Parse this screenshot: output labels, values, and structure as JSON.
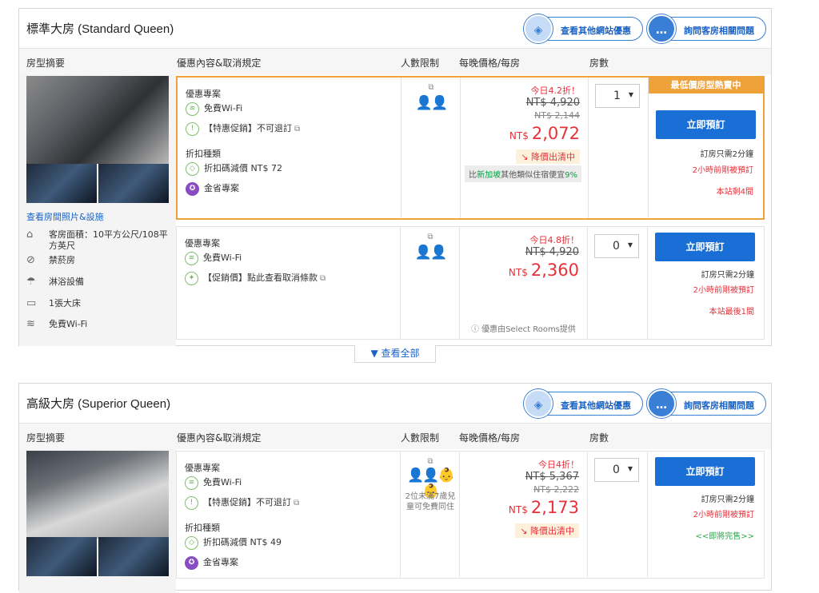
{
  "cards": [
    {
      "title": "標準大房 (Standard Queen)",
      "pill_other": "查看其他網站優惠",
      "pill_ask": "詢問客房相關問題",
      "columns": {
        "summary": "房型摘要",
        "offer": "優惠內容&取消規定",
        "occupancy": "人數限制",
        "price": "每晚價格/每房",
        "rooms": "房數"
      },
      "photo_link": "查看房間照片&設施",
      "features": [
        {
          "icon": "house-icon",
          "glyph": "⌂",
          "text": "客房面積：10平方公尺/108平方英尺"
        },
        {
          "icon": "no-smoking-icon",
          "glyph": "⊘",
          "text": "禁菸房"
        },
        {
          "icon": "shower-icon",
          "glyph": "☂",
          "text": "淋浴設備"
        },
        {
          "icon": "bed-icon",
          "glyph": "▭",
          "text": "1張大床"
        },
        {
          "icon": "wifi-icon",
          "glyph": "≋",
          "text": "免費Wi-Fi"
        }
      ],
      "offers": [
        {
          "section1": "優惠專案",
          "wifi": "免費Wi-Fi",
          "policy": "【特惠促銷】不可退訂",
          "section2": "折扣種類",
          "coupon": "折扣碼減價 NT$ 72",
          "gold": "金省專案",
          "discount": "今日4.2折！",
          "strike1": "NT$ 4,920",
          "strike2": "NT$ 2,144",
          "currency": "NT$",
          "price": "2,072",
          "drop": "↘ 降價出清中",
          "compare_pre": "比",
          "compare_hl": "新加坡",
          "compare_post": "其他類似住宿便宜",
          "compare_pct": "9%",
          "rooms": "1",
          "banner": "最低價房型熱賣中",
          "book": "立即預訂",
          "note1": "訂房只需2分鐘",
          "note2": "2小時前剛被預訂",
          "note3": "本站剩4間"
        },
        {
          "section1": "優惠專案",
          "wifi": "免費Wi-Fi",
          "policy": "【促銷價】點此查看取消條款",
          "discount": "今日4.8折！",
          "strike1": "NT$ 4,920",
          "currency": "NT$",
          "price": "2,360",
          "provider": "ⓘ 優惠由Select Rooms提供",
          "rooms": "0",
          "book": "立即預訂",
          "note1": "訂房只需2分鐘",
          "note2": "2小時前剛被預訂",
          "note3": "本站最後1間"
        }
      ],
      "expand": "▼ 查看全部"
    },
    {
      "title": "高級大房 (Superior Queen)",
      "pill_other": "查看其他網站優惠",
      "pill_ask": "詢問客房相關問題",
      "columns": {
        "summary": "房型摘要",
        "offer": "優惠內容&取消規定",
        "occupancy": "人數限制",
        "price": "每晚價格/每房",
        "rooms": "房數"
      },
      "offers": [
        {
          "section1": "優惠專案",
          "wifi": "免費Wi-Fi",
          "policy": "【特惠促銷】不可退訂",
          "section2": "折扣種類",
          "coupon": "折扣碼減價 NT$ 49",
          "gold": "金省專案",
          "occ_note": "2位未滿7歲兒童可免費同住",
          "discount": "今日4折！",
          "strike1": "NT$ 5,367",
          "strike2": "NT$ 2,222",
          "currency": "NT$",
          "price": "2,173",
          "drop": "↘ 降價出清中",
          "rooms": "0",
          "book": "立即預訂",
          "note1": "訂房只需2分鐘",
          "note2": "2小時前剛被預訂",
          "note3": "<<即將完售>>"
        }
      ]
    }
  ]
}
